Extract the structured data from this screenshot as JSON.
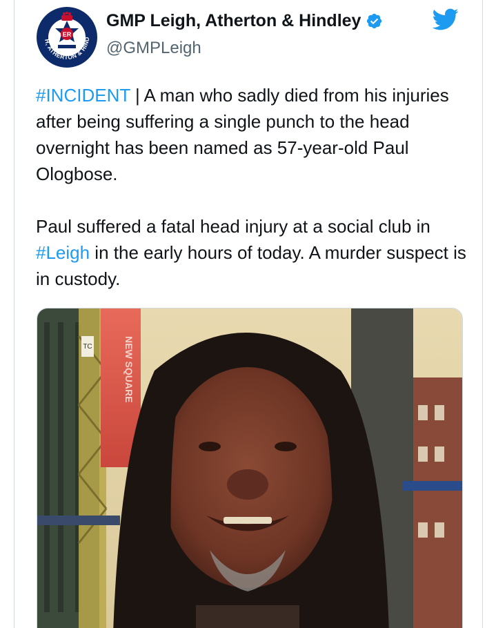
{
  "account": {
    "display_name": "GMP Leigh, Atherton & Hindley",
    "handle": "@GMPLeigh",
    "badge_ring_text": "LEIGH, ATHERTON & HINDLEY",
    "badge_crest_text": "ER"
  },
  "tweet": {
    "hashtag1": "#INCIDENT",
    "line1_rest": " | A man who sadly died from his injuries after being suffering a single punch to the head overnight has been named as 57-year-old Paul Ologbose.",
    "para2_before": "Paul suffered a fatal head injury at a social club in ",
    "hashtag2": "#Leigh",
    "para2_after": " in the early hours of today. A murder suspect is in custody."
  },
  "photo": {
    "sign_text": "NEW SQUARE",
    "sign_small": "TC"
  },
  "colors": {
    "link": "#1d9bf0",
    "twitter_blue": "#1d9bf0",
    "text": "#0f1419",
    "secondary": "#536471",
    "badge_navy": "#0d2a6b"
  },
  "icons": [
    "verified-badge-icon",
    "twitter-bird-icon",
    "police-badge-avatar"
  ]
}
